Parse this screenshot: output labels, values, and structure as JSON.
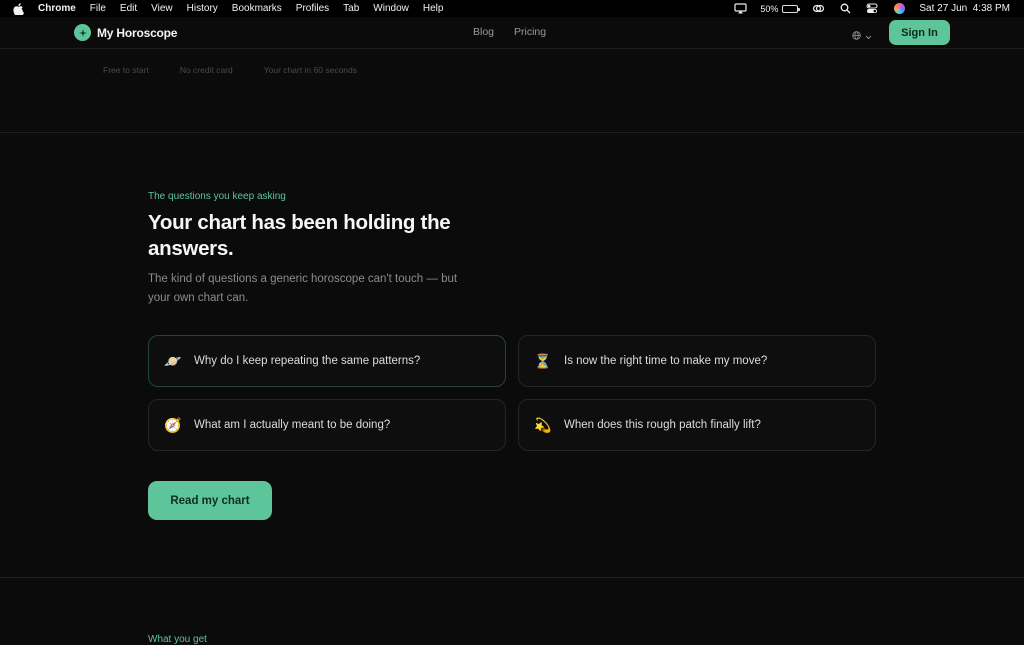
{
  "menubar": {
    "app_name": "Chrome",
    "items": [
      "File",
      "Edit",
      "View",
      "History",
      "Bookmarks",
      "Profiles",
      "Tab",
      "Window",
      "Help"
    ],
    "battery_percent": "50%",
    "battery_level": 0.5,
    "datetime": "Sat 27 Jun  4:38 PM"
  },
  "nav": {
    "logo_text": "My Horoscope",
    "links": [
      "Blog",
      "Pricing"
    ],
    "signin_label": "Sign In"
  },
  "trust": [
    "Free to start",
    "No credit card",
    "Your chart in 60 seconds"
  ],
  "section": {
    "eyebrow": "The questions you keep asking",
    "heading": "Your chart has been holding the answers.",
    "subtitle": "The kind of questions a generic horoscope can't touch — but your own chart can.",
    "questions": [
      {
        "icon": "ringed-planet-icon",
        "glyph": "🪐",
        "text": "Why do I keep repeating the same patterns?"
      },
      {
        "icon": "hourglass-icon",
        "glyph": "⏳",
        "text": "Is now the right time to make my move?"
      },
      {
        "icon": "compass-icon",
        "glyph": "🧭",
        "text": "What am I actually meant to be doing?"
      },
      {
        "icon": "dizzy-star-icon",
        "glyph": "💫",
        "text": "When does this rough patch finally lift?"
      }
    ],
    "cta_label": "Read my chart"
  },
  "next_section": {
    "eyebrow": "What you get"
  },
  "colors": {
    "accent": "#5ec59a",
    "background": "#0b0b0b",
    "card_border": "#262626"
  }
}
